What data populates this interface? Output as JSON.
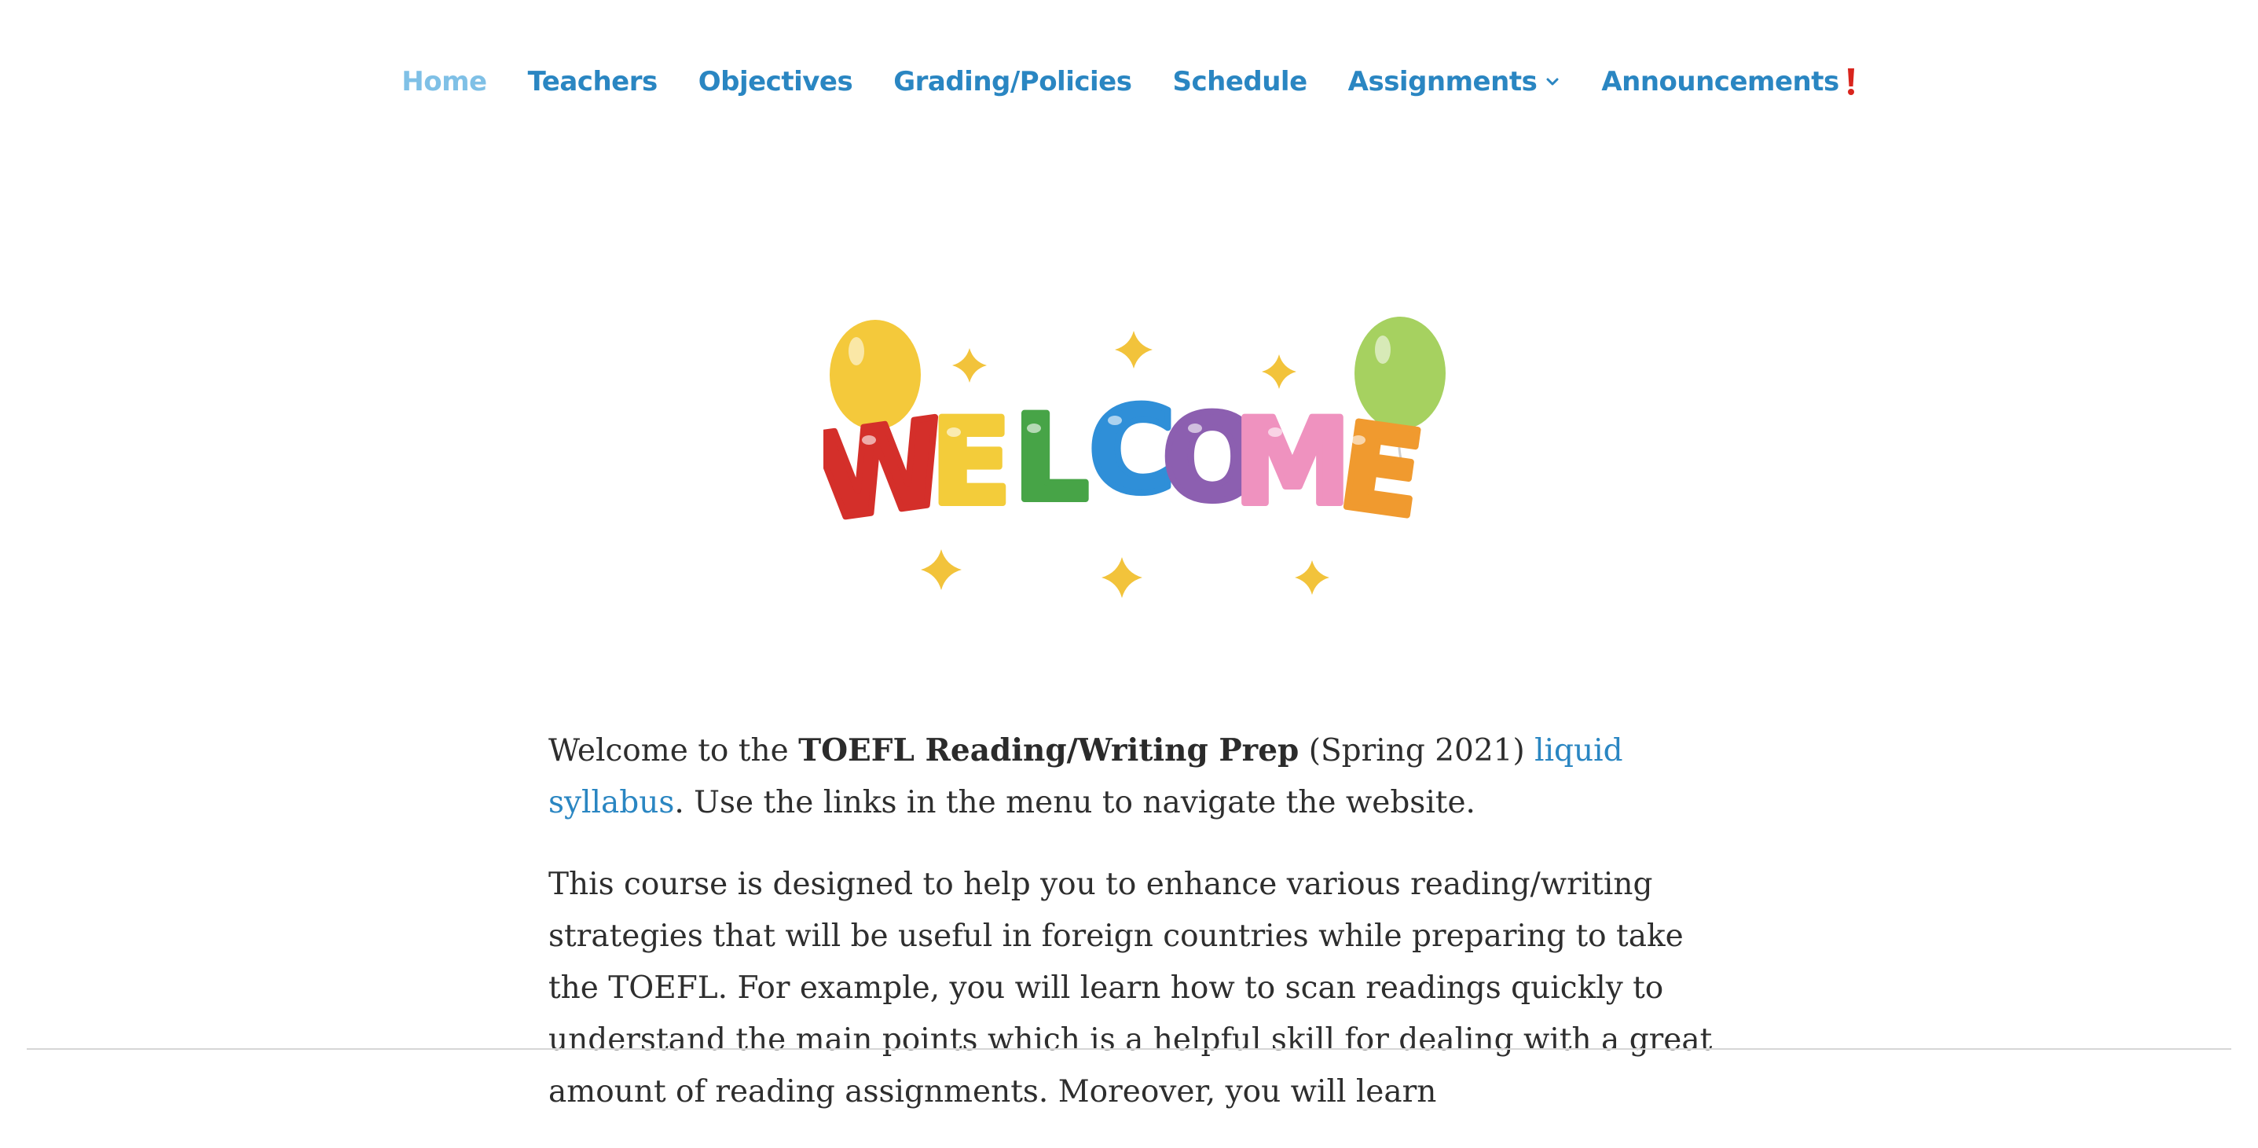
{
  "nav": {
    "items": [
      {
        "label": "Home",
        "active": true
      },
      {
        "label": "Teachers"
      },
      {
        "label": "Objectives"
      },
      {
        "label": "Grading/Policies"
      },
      {
        "label": "Schedule"
      },
      {
        "label": "Assignments",
        "has_dropdown": true
      },
      {
        "label": "Announcements",
        "icon": "exclamation-icon"
      }
    ]
  },
  "hero": {
    "letters": [
      "W",
      "E",
      "L",
      "C",
      "O",
      "M",
      "E"
    ],
    "letter_colors": [
      "#d42f2a",
      "#f3cc3a",
      "#47a447",
      "#2f8fd8",
      "#8c5fb0",
      "#ef92bf",
      "#f09a2f"
    ],
    "balloon_colors": [
      "#f4c93b",
      "#a6d160"
    ],
    "star_color": "#f2c33b"
  },
  "content": {
    "p1_intro": "Welcome to the ",
    "p1_course": "TOEFL Reading/Writing Prep",
    "p1_term": " (Spring 2021) ",
    "p1_link": "liquid syllabus",
    "p1_rest": ". Use the links in the menu to navigate the website.",
    "p2": "This course is designed to help you to enhance various reading/writing strategies that will be useful in foreign countries while preparing to take the TOEFL. For example, you will learn how to scan readings quickly to understand the main points which is a helpful skill for dealing with a great amount of reading assignments. Moreover, you will learn"
  },
  "colors": {
    "link": "#2a86c2",
    "nav_active": "#7fc0e6",
    "text": "#2e2e2e",
    "alert": "#d9251d"
  }
}
